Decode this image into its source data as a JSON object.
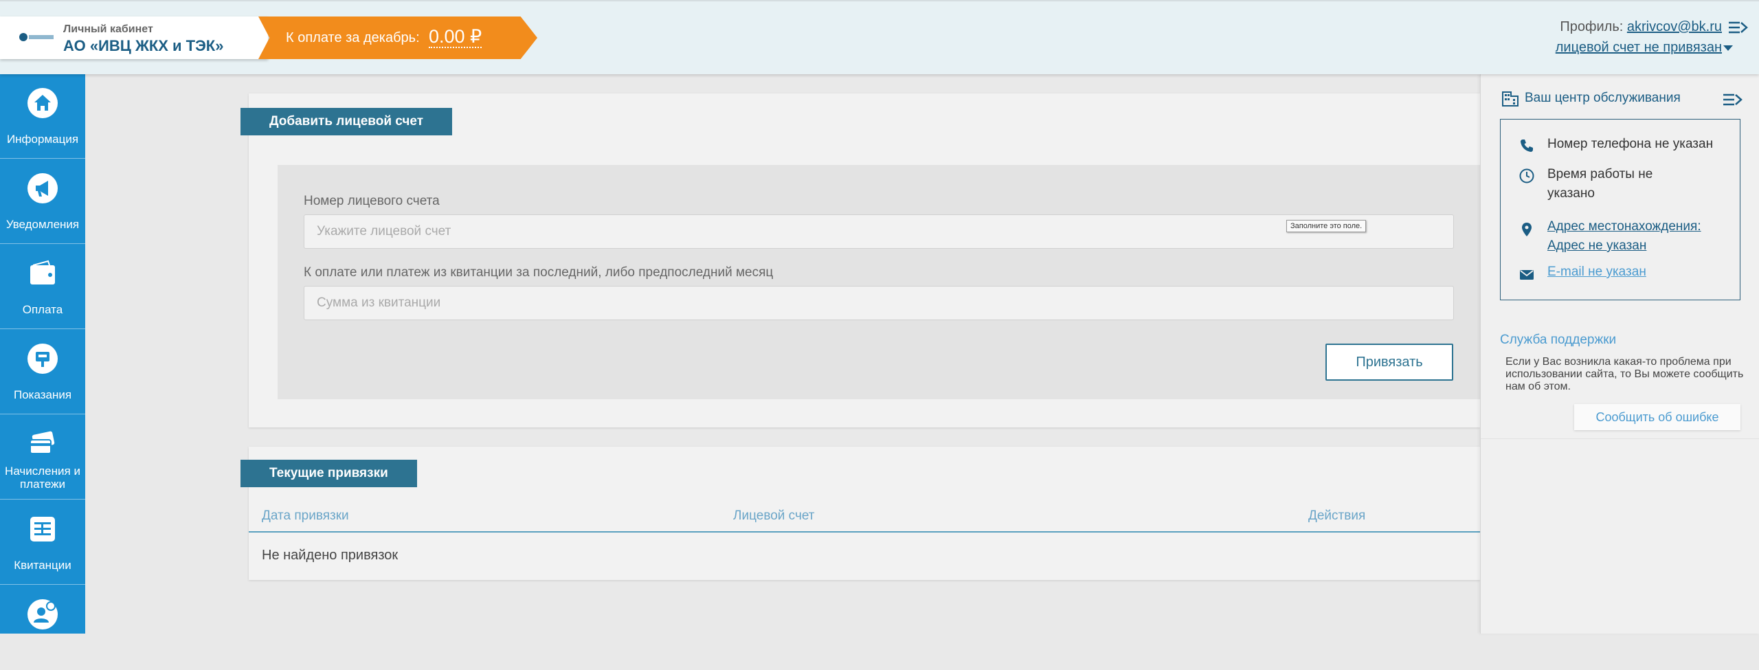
{
  "header": {
    "brand_subtitle": "Личный кабинет",
    "brand_name": "АО «ИВЦ ЖКХ и ТЭК»",
    "payment_label": "К оплате за декабрь:",
    "payment_amount": "0.00 ₽",
    "profile_label": "Профиль:",
    "profile_email": "akrivcov@bk.ru",
    "account_status": "лицевой счет не привязан"
  },
  "sidebar": {
    "items": [
      {
        "label": "Информация",
        "icon": "home-icon"
      },
      {
        "label": "Уведомления",
        "icon": "megaphone-icon"
      },
      {
        "label": "Оплата",
        "icon": "wallet-icon"
      },
      {
        "label": "Показания",
        "icon": "meter-icon"
      },
      {
        "label": "Начисления и платежи",
        "icon": "cards-icon"
      },
      {
        "label": "Квитанции",
        "icon": "receipt-icon"
      },
      {
        "label": "",
        "icon": "user-chat-icon"
      }
    ]
  },
  "add_account": {
    "section_title": "Добавить лицевой счет",
    "account_label": "Номер лицевого счета",
    "account_placeholder": "Укажите лицевой счет",
    "tooltip": "Заполните это поле.",
    "amount_label": "К оплате или платеж из квитанции за последний, либо предпоследний месяц",
    "amount_placeholder": "Сумма из квитанции",
    "bind_button": "Привязать"
  },
  "bindings": {
    "section_title": "Текущие привязки",
    "columns": [
      "Дата привязки",
      "Лицевой счет",
      "Действия"
    ],
    "empty_text": "Не найдено привязок"
  },
  "service_center": {
    "title": "Ваш центр обслуживания",
    "phone": "Номер телефона не указан",
    "hours": "Время работы не указано",
    "address": "Адрес местонахождения: Адрес не указан",
    "email": "E-mail не указан"
  },
  "support": {
    "title": "Служба поддержки",
    "text": "Если у Вас возникла какая-то проблема при использовании сайта, то Вы можете сообщить нам об этом.",
    "button": "Сообщить об ошибке"
  },
  "colors": {
    "sidebar": "#1a8fd1",
    "accent": "#2d7391",
    "payment_banner": "#f28c1c",
    "header_bg": "#e7f1f4"
  }
}
